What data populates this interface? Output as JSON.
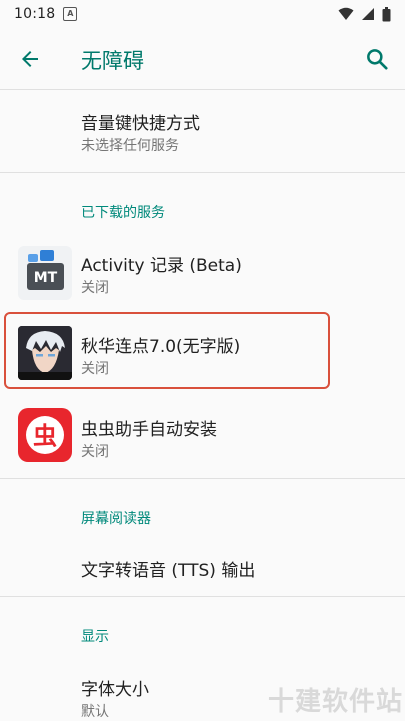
{
  "status_bar": {
    "time": "10:18",
    "notif_letter": "A"
  },
  "app_bar": {
    "title": "无障碍"
  },
  "shortcut": {
    "title": "音量键快捷方式",
    "subtitle": "未选择任何服务"
  },
  "sections": {
    "downloaded": "已下载的服务",
    "screen_readers": "屏幕阅读器",
    "display": "显示"
  },
  "services": [
    {
      "title": "Activity 记录 (Beta)",
      "subtitle": "关闭",
      "icon_text": "MT"
    },
    {
      "title": "秋华连点7.0(无字版)",
      "subtitle": "关闭"
    },
    {
      "title": "虫虫助手自动安装",
      "subtitle": "关闭",
      "icon_text": "虫"
    }
  ],
  "tts": {
    "title": "文字转语音 (TTS) 输出"
  },
  "font_size": {
    "title": "字体大小",
    "subtitle": "默认"
  },
  "colors": {
    "accent": "#00796b",
    "highlight": "#d9503c",
    "chong_red": "#e8262d"
  },
  "watermark": "十建软件站"
}
